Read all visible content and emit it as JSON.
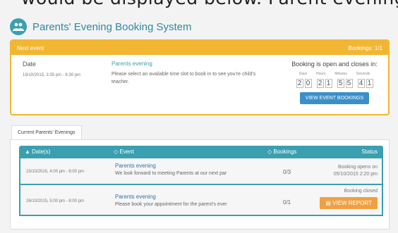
{
  "caption": "would be displayed below. Parent evening",
  "app": {
    "title": "Parents' Evening Booking System"
  },
  "next_event": {
    "header": "Next event",
    "bookings": "Bookings: 1/1",
    "date_label": "Date",
    "date_value": "19/10/2015, 3:35 pm - 6:30 pm",
    "event_name": "Parents evening",
    "event_desc": "Please select an available time slot to book in to see you're child's teacher.",
    "countdown_title": "Booking is open and closes in:",
    "units": [
      "Days",
      "Hours",
      "Minutes",
      "Seconds"
    ],
    "digits": [
      "2",
      "0",
      "2",
      "1",
      "5",
      "5",
      "4",
      "1"
    ],
    "view_button": "VIEW EVENT BOOKINGS"
  },
  "tabs": {
    "current": "Current Parents' Evenings"
  },
  "table": {
    "headers": [
      "▲ Date(s)",
      "◇ Event",
      "◇ Bookings",
      "Status"
    ],
    "rows": [
      {
        "date": "23/10/2015, 4:00 pm - 8:00 pm",
        "event": "Parents evening",
        "desc": "We look forward to meeting Parents at our next par",
        "bookings": "0/3",
        "status1": "Booking opens on",
        "status2": "05/10/2015 2:20 pm"
      },
      {
        "date": "26/10/2015, 5:00 pm - 8:00 pm",
        "event": "Parents evening",
        "desc": "Please book your appointment for the parent's ever",
        "bookings": "0/1",
        "status1": "Booking closed",
        "report": "VIEW REPORT"
      }
    ]
  },
  "colors": {
    "accent": "#3a9fb1",
    "warning": "#f2b632",
    "button_blue": "#3b8fc9",
    "button_orange": "#f0a042"
  },
  "icons": [
    "users-icon",
    "document-icon"
  ]
}
